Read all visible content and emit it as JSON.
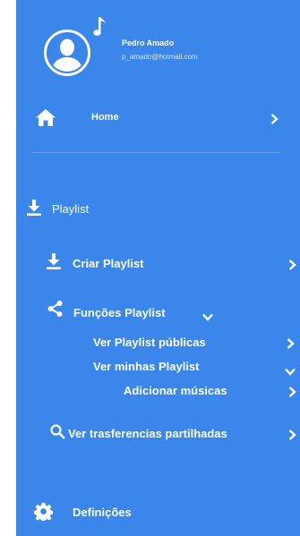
{
  "user": {
    "name": "Pedro Amado",
    "email": "p_amado@hotmail.com"
  },
  "menu": {
    "home": {
      "label": "Home",
      "icon": "home-icon"
    },
    "playlist": {
      "label": "Playlist",
      "icon": "download-icon"
    },
    "criar_playlist": {
      "label": "Criar Playlist",
      "icon": "download-icon"
    },
    "funcoes_playlist": {
      "label": "Funções Playlist",
      "icon": "share-icon"
    },
    "ver_publicas": {
      "label": "Ver Playlist públicas"
    },
    "ver_minhas": {
      "label": "Ver minhas Playlist"
    },
    "adicionar_musicas": {
      "label": "Adicionar músicas"
    },
    "ver_trasferencias": {
      "label": "Ver trasferencias partilhadas",
      "icon": "search-icon"
    },
    "definicoes": {
      "label": "Definições",
      "icon": "gear-icon"
    }
  },
  "colors": {
    "drawer_background": "#3b86ea",
    "text": "#ffffff",
    "divider": "#63a0f0"
  }
}
